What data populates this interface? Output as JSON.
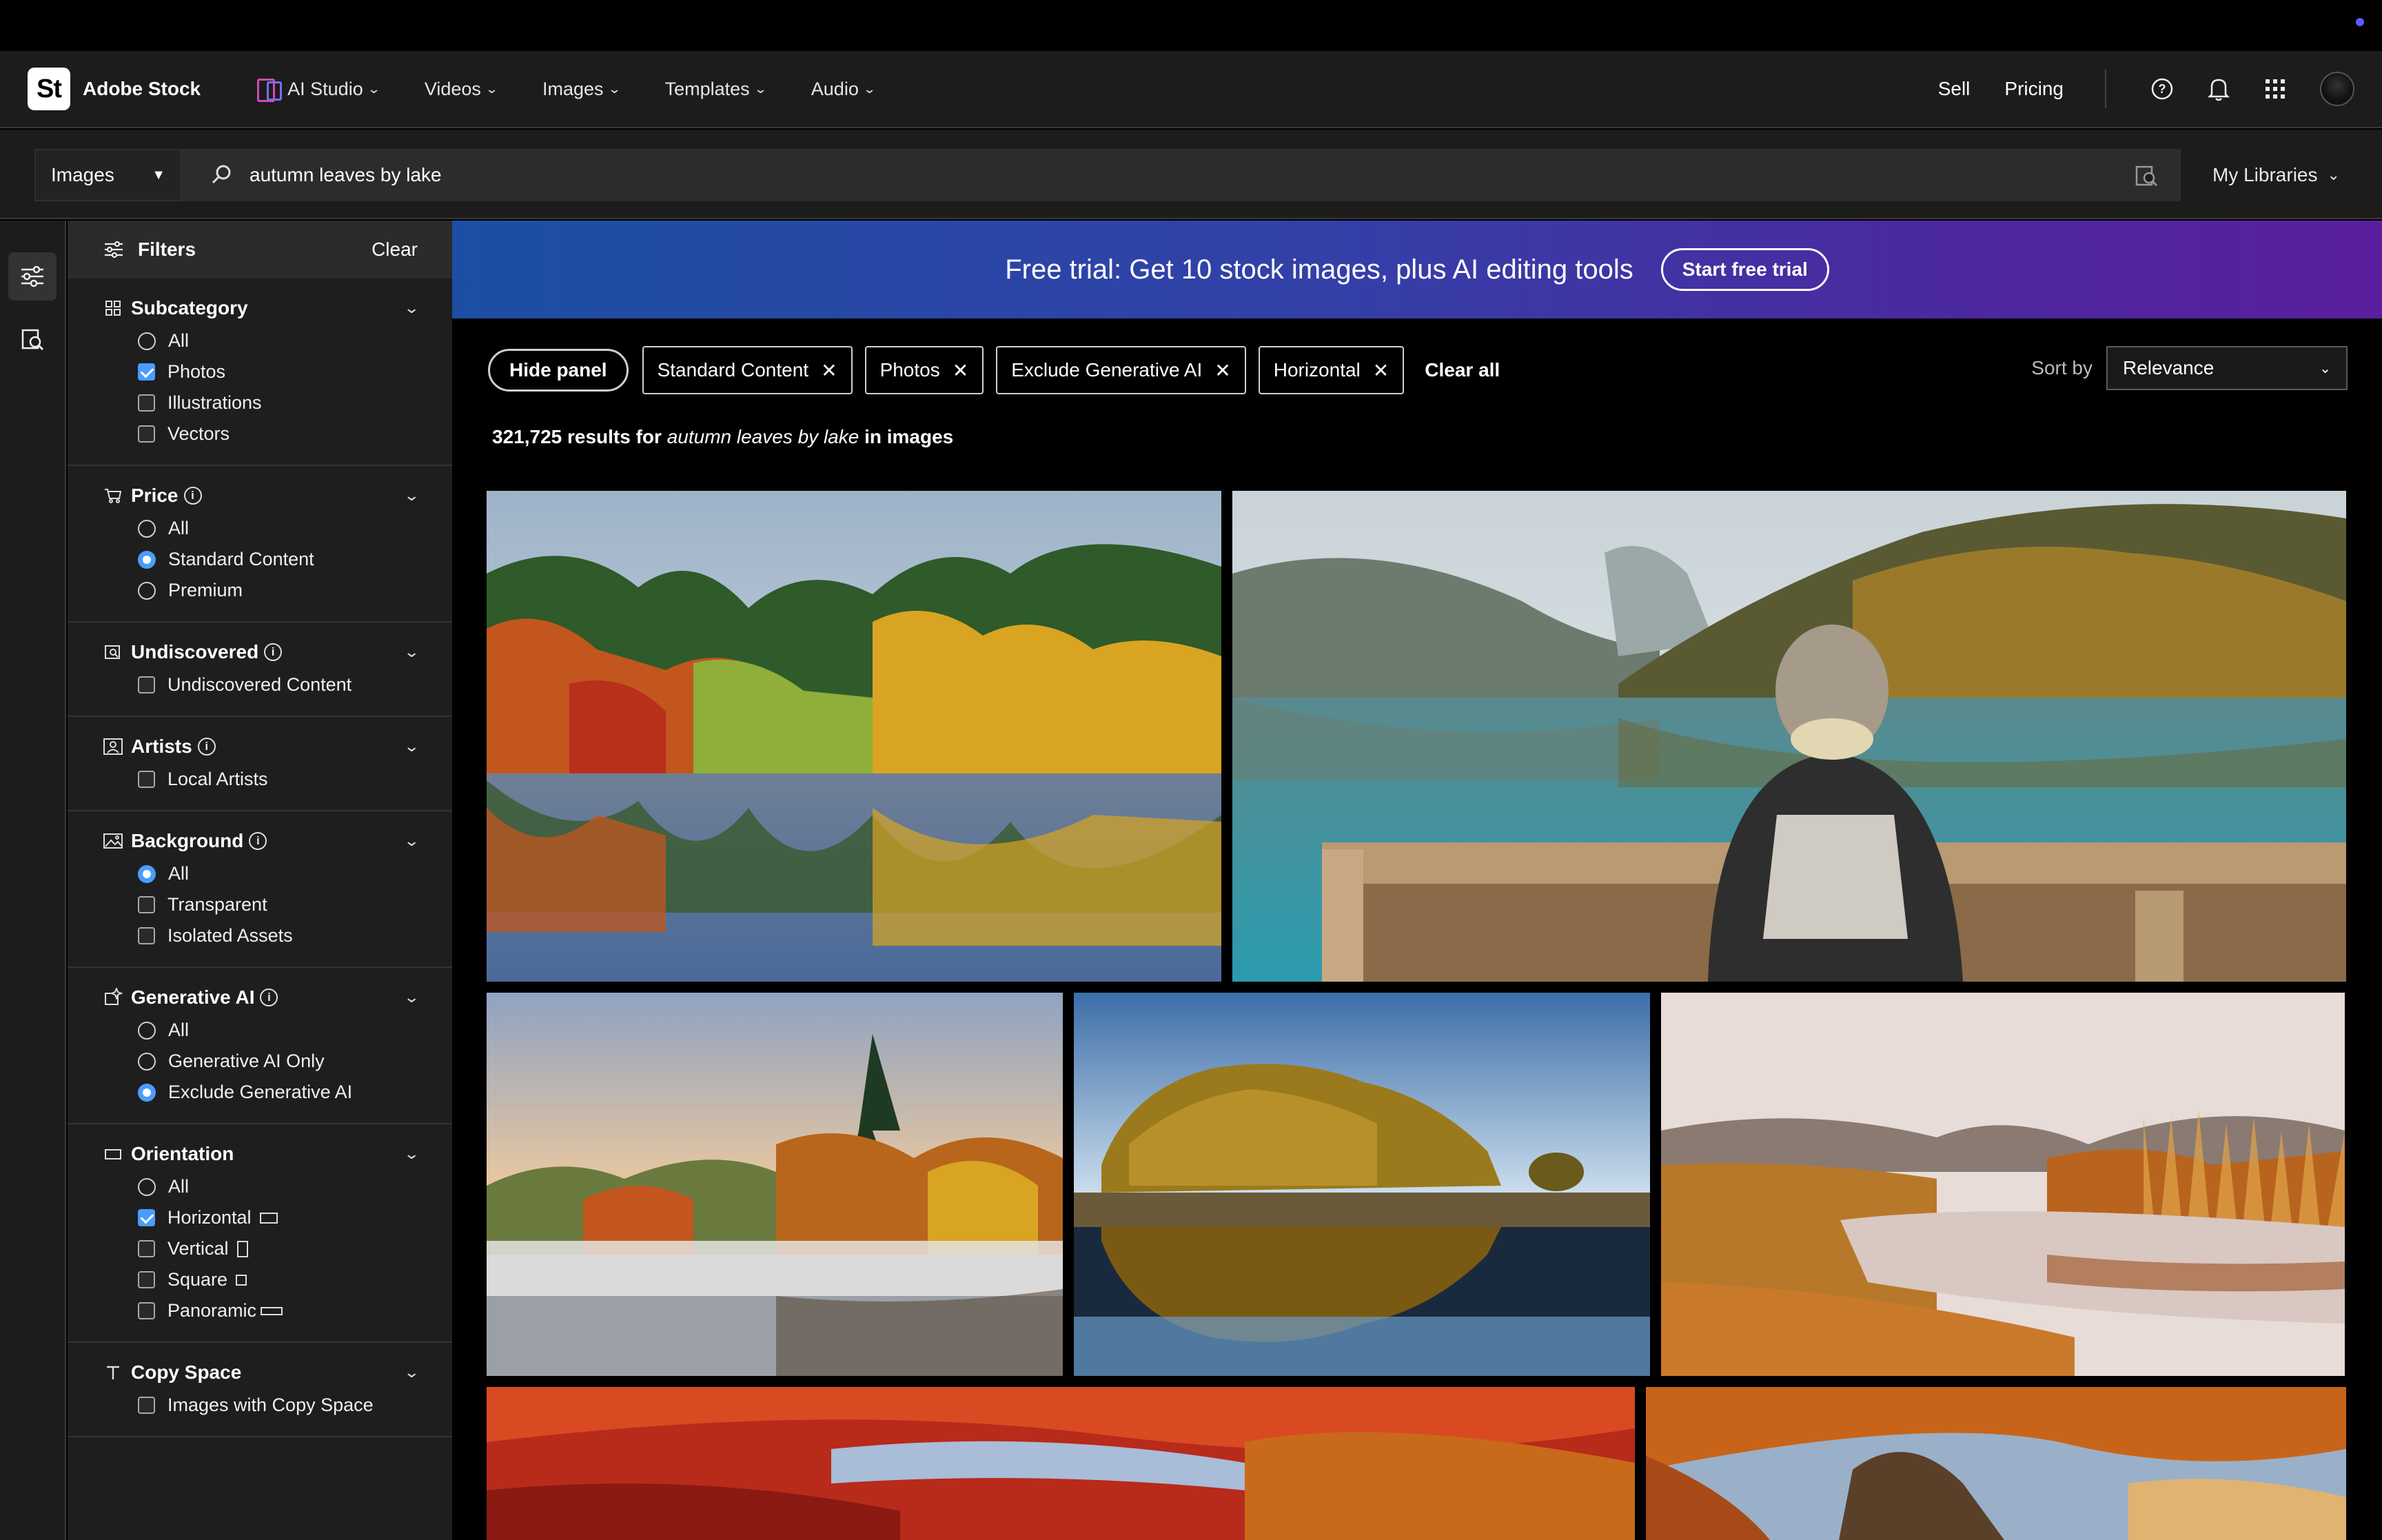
{
  "header": {
    "logo": "St",
    "brand": "Adobe Stock",
    "nav": [
      {
        "label": "AI Studio"
      },
      {
        "label": "Videos"
      },
      {
        "label": "Images"
      },
      {
        "label": "Templates"
      },
      {
        "label": "Audio"
      }
    ],
    "links": {
      "sell": "Sell",
      "pricing": "Pricing"
    },
    "icons": [
      "help-icon",
      "bell-icon",
      "apps-grid-icon",
      "avatar"
    ]
  },
  "search": {
    "type": "Images",
    "query": "autumn leaves by lake",
    "libraries": "My Libraries"
  },
  "filters": {
    "title": "Filters",
    "clear": "Clear",
    "subcategory": {
      "label": "Subcategory",
      "options": [
        "All",
        "Photos",
        "Illustrations",
        "Vectors"
      ]
    },
    "price": {
      "label": "Price",
      "options": [
        "All",
        "Standard Content",
        "Premium"
      ]
    },
    "undiscovered": {
      "label": "Undiscovered",
      "options": [
        "Undiscovered Content"
      ]
    },
    "artists": {
      "label": "Artists",
      "options": [
        "Local Artists"
      ]
    },
    "background": {
      "label": "Background",
      "options": [
        "All",
        "Transparent",
        "Isolated Assets"
      ]
    },
    "generative": {
      "label": "Generative AI",
      "options": [
        "All",
        "Generative AI Only",
        "Exclude Generative AI"
      ]
    },
    "orientation": {
      "label": "Orientation",
      "options": [
        "All",
        "Horizontal",
        "Vertical",
        "Square",
        "Panoramic"
      ]
    },
    "copyspace": {
      "label": "Copy Space",
      "options": [
        "Images with Copy Space"
      ]
    }
  },
  "banner": {
    "text": "Free trial: Get 10 stock images, plus AI editing tools",
    "button": "Start free trial"
  },
  "toolbar": {
    "hide_panel": "Hide panel",
    "chips": [
      "Standard Content",
      "Photos",
      "Exclude Generative AI",
      "Horizontal"
    ],
    "clear_all": "Clear all",
    "sort_label": "Sort by",
    "sort_value": "Relevance"
  },
  "results": {
    "count": "321,725 results for",
    "query": "autumn leaves by lake",
    "scope": "in images"
  },
  "colors": {
    "accent": "#4a9cff",
    "banner_start": "#1c4fa3",
    "banner_end": "#5a1e9e"
  }
}
